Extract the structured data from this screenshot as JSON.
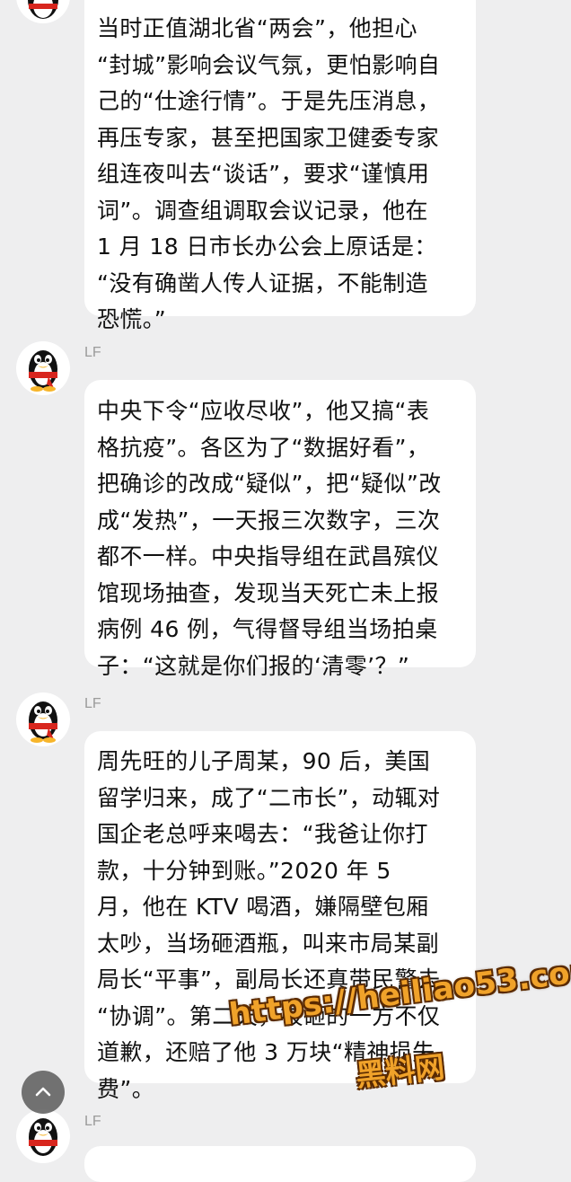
{
  "messages": [
    {
      "sender": "",
      "text": "当时正值湖北省“两会”，他担心\n“封城”影响会议气氛，更怕影响自\n己的“仕途行情”。于是先压消息，\n再压专家，甚至把国家卫健委专家\n组连夜叫去“谈话”，要求“谨慎用\n词”。调查组调取会议记录，他在\n1 月 18 日市长办公会上原话是：\n“没有确凿人传人证据，不能制造\n恐慌。”"
    },
    {
      "sender": "LF",
      "text": "中央下令“应收尽收”，他又搞“表\n格抗疫”。各区为了“数据好看”，\n把确诊的改成“疑似”，把“疑似”改\n成“发热”，一天报三次数字，三次\n都不一样。中央指导组在武昌殡仪\n馆现场抽查，发现当天死亡未上报\n病例 46 例，气得督导组当场拍桌\n子：“这就是你们报的‘清零’？”"
    },
    {
      "sender": "LF",
      "text": "周先旺的儿子周某，90 后，美国\n留学归来，成了“二市长”，动辄对\n国企老总呼来喝去：“我爸让你打\n款，十分钟到账。”2020 年 5\n月，他在 KTV 喝酒，嫌隔壁包厢\n太吵，当场砸酒瓶，叫来市局某副\n局长“平事”，副局长还真带民警去\n“协调”。第二天，被砸的一方不仅\n道歉，还赔了他 3 万块“精神损失\n费”。"
    },
    {
      "sender": "LF",
      "text": ""
    }
  ],
  "watermark": {
    "url": "https://heiliao53.com",
    "name": "黑料网"
  },
  "icons": {
    "avatar": "qq-penguin-icon",
    "scroll": "chevron-up-icon"
  },
  "colors": {
    "background": "#eeeeef",
    "bubble": "#ffffff",
    "text": "#111111",
    "sender": "#9b9b9b",
    "watermark": "#f0a22a"
  }
}
